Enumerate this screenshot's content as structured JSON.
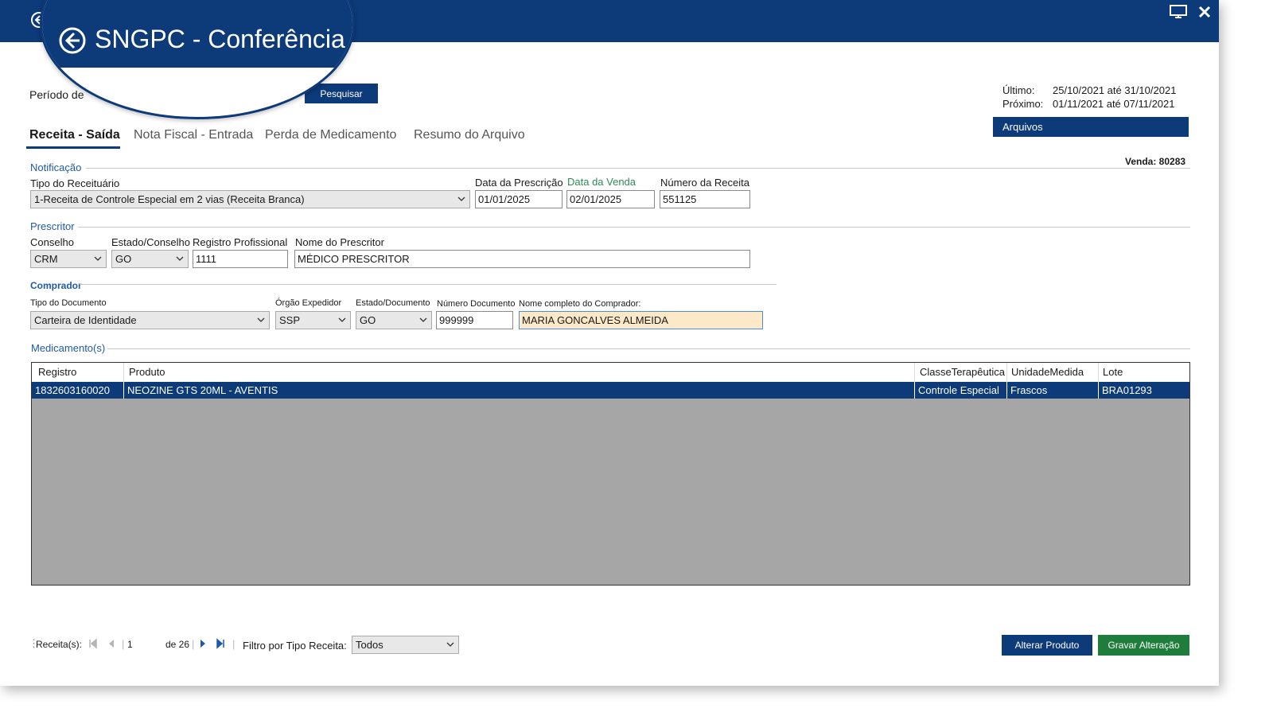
{
  "window": {
    "title": "SNGPC - Conferência"
  },
  "filter": {
    "period_label": "Período de",
    "search_button": "Pesquisar"
  },
  "status": {
    "last_label": "Último:",
    "last_value": "25/10/2021 até 31/10/2021",
    "next_label": "Próximo:",
    "next_value": "01/11/2021 até 07/11/2021",
    "files_button": "Arquivos",
    "sale_label": "Venda: 80283"
  },
  "tabs": [
    {
      "label": "Receita - Saída",
      "active": true
    },
    {
      "label": "Nota Fiscal - Entrada",
      "active": false
    },
    {
      "label": "Perda de Medicamento",
      "active": false
    },
    {
      "label": "Resumo do Arquivo",
      "active": false
    }
  ],
  "notificacao": {
    "section": "Notificação",
    "tipo_label": "Tipo do Receituário",
    "tipo_value": "1-Receita de Controle Especial em 2 vias (Receita Branca)",
    "data_prescricao_label": "Data da Prescrição",
    "data_prescricao_value": "01/01/2025",
    "data_venda_label": "Data da Venda",
    "data_venda_value": "02/01/2025",
    "numero_receita_label": "Número da Receita",
    "numero_receita_value": "551125"
  },
  "prescritor": {
    "section": "Prescritor",
    "conselho_label": "Conselho",
    "conselho_value": "CRM",
    "estado_label": "Estado/Conselho",
    "estado_value": "GO",
    "registro_label": "Registro Profissional",
    "registro_value": "1111",
    "nome_label": "Nome do Prescritor",
    "nome_value": "MÉDICO PRESCRITOR"
  },
  "comprador": {
    "section": "Comprador",
    "tipo_doc_label": "Tipo do Documento",
    "tipo_doc_value": "Carteira de Identidade",
    "orgao_label": "Órgão Expedidor",
    "orgao_value": "SSP",
    "estado_doc_label": "Estado/Documento",
    "estado_doc_value": "GO",
    "numero_doc_label": "Número Documento",
    "numero_doc_value": "999999",
    "nome_label": "Nome completo do Comprador:",
    "nome_value": "MARIA GONCALVES ALMEIDA"
  },
  "medicamentos": {
    "section": "Medicamento(s)",
    "columns": [
      "Registro",
      "Produto",
      "ClasseTerapêutica",
      "UnidadeMedida",
      "Lote"
    ],
    "rows": [
      [
        "1832603160020",
        "NEOZINE GTS 20ML - AVENTIS",
        "Controle Especial",
        "Frascos",
        "BRA01293"
      ]
    ]
  },
  "footer": {
    "receitas_label": "Receita(s):",
    "page_value": "1",
    "page_total": "de 26",
    "filtro_label": "Filtro por Tipo Receita:",
    "filtro_value": "Todos",
    "alterar_button": "Alterar Produto",
    "gravar_button": "Gravar Alteração"
  },
  "colors": {
    "primary": "#0d3a78",
    "success": "#1e7d3a",
    "grid_bg": "#a6a6a6",
    "highlight": "#fde9c8"
  }
}
